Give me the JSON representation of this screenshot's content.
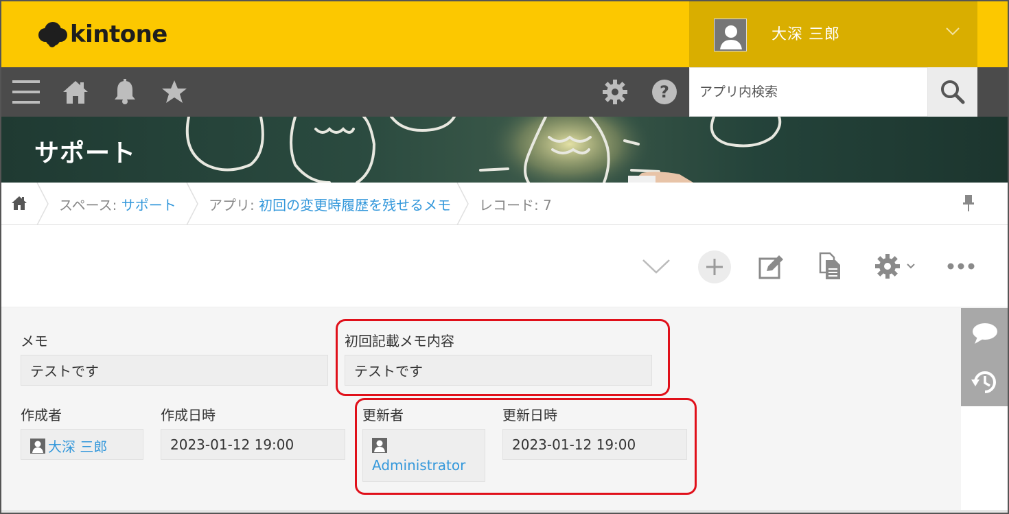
{
  "header": {
    "logo_text": "kintone",
    "user_name": "大深 三郎"
  },
  "navbar": {
    "icons": [
      "menu-icon",
      "home-icon",
      "bell-icon",
      "star-icon",
      "gear-icon",
      "help-icon"
    ],
    "search_placeholder": "アプリ内検索"
  },
  "banner": {
    "title": "サポート"
  },
  "breadcrumb": {
    "space_prefix": "スペース: ",
    "space_name": "サポート",
    "app_prefix": "アプリ: ",
    "app_name": "初回の変更時履歴を残せるメモ",
    "record_label": "レコード: 7"
  },
  "toolbar": {
    "icons": [
      "chevron-down-icon",
      "add-icon",
      "edit-icon",
      "copy-icon",
      "gear-icon",
      "more-icon"
    ]
  },
  "fields": {
    "memo_label": "メモ",
    "memo_value": "テストです",
    "first_memo_label": "初回記載メモ内容",
    "first_memo_value": "テストです",
    "creator_label": "作成者",
    "creator_value": "大深 三郎",
    "created_label": "作成日時",
    "created_value": "2023-01-12 19:00",
    "updater_label": "更新者",
    "updater_value": "Administrator",
    "updated_label": "更新日時",
    "updated_value": "2023-01-12 19:00"
  },
  "colors": {
    "header_yellow": "#fcc800",
    "user_box": "#d9ae00",
    "navbar": "#4b4b4b",
    "link_blue": "#3498db",
    "highlight_red": "#e0101a"
  }
}
